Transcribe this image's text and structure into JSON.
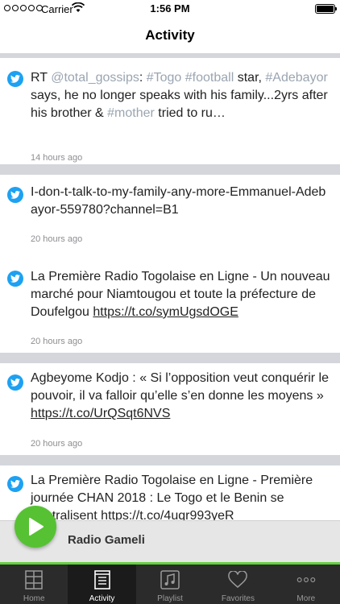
{
  "status_bar": {
    "carrier": "Carrier",
    "time": "1:56 PM"
  },
  "nav": {
    "title": "Activity"
  },
  "feed": [
    {
      "icon": "twitter-icon",
      "prefix": "RT ",
      "handle": "@total_gossips",
      "t1": ": ",
      "tag1": "#Togo",
      "sp1": " ",
      "tag2": "#football",
      "t2": " star, ",
      "tag3": "#Adebayor",
      "t3": " says, he no longer speaks with his family...2yrs after his brother & ",
      "tag4": "#mother",
      "t4": " tried to ru…",
      "time": "14 hours ago"
    },
    {
      "icon": "twitter-icon",
      "text": "I-don-t-talk-to-my-family-any-more-Emmanuel-Adebayor-559780?channel=B1",
      "time": "20 hours ago"
    },
    {
      "icon": "twitter-icon",
      "text": "La Première Radio Togolaise en Ligne - Un nouveau marché pour Niamtougou et toute la préfecture de Doufelgou ",
      "link": "https://t.co/symUgsdOGE",
      "time": "20 hours ago"
    },
    {
      "icon": "twitter-icon",
      "text": "Agbeyome Kodjo : « Si l’opposition veut conquérir le pouvoir, il va falloir qu’elle s’en donne les moyens » ",
      "link": "https://t.co/UrQSqt6NVS",
      "time": "20 hours ago"
    },
    {
      "icon": "twitter-icon",
      "text": "La Première Radio Togolaise en Ligne - Première journée CHAN 2018 : Le Togo et le Benin se neutralisent ",
      "link": "https://t.co/4uqr993yeR"
    }
  ],
  "player": {
    "station": "Radio Gameli",
    "play_icon": "play-icon"
  },
  "tabs": [
    {
      "label": "Home",
      "icon": "grid-icon"
    },
    {
      "label": "Activity",
      "icon": "activity-icon",
      "active": true
    },
    {
      "label": "Playlist",
      "icon": "music-note-icon"
    },
    {
      "label": "Favorites",
      "icon": "heart-icon"
    },
    {
      "label": "More",
      "icon": "ellipsis-icon"
    }
  ],
  "colors": {
    "twitter": "#1da1f2",
    "accent_green": "#56c233",
    "hashtag": "#9aa5b1",
    "tab_bar": "#2b2b2b"
  }
}
